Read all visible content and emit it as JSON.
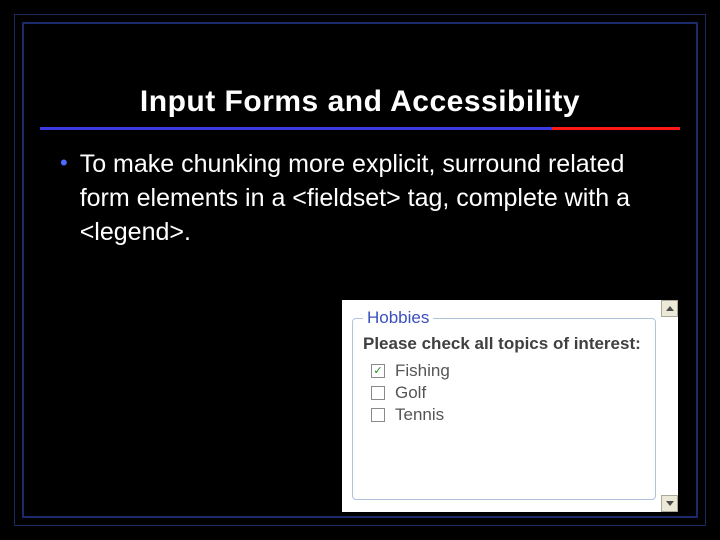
{
  "slide": {
    "title": "Input Forms and Accessibility",
    "bullet": "To make chunking more explicit, surround related form elements in a <fieldset> tag, complete with a <legend>."
  },
  "embed": {
    "legend": "Hobbies",
    "prompt": "Please check all topics of interest:",
    "options": [
      {
        "label": "Fishing",
        "checked": true
      },
      {
        "label": "Golf",
        "checked": false
      },
      {
        "label": "Tennis",
        "checked": false
      }
    ]
  }
}
